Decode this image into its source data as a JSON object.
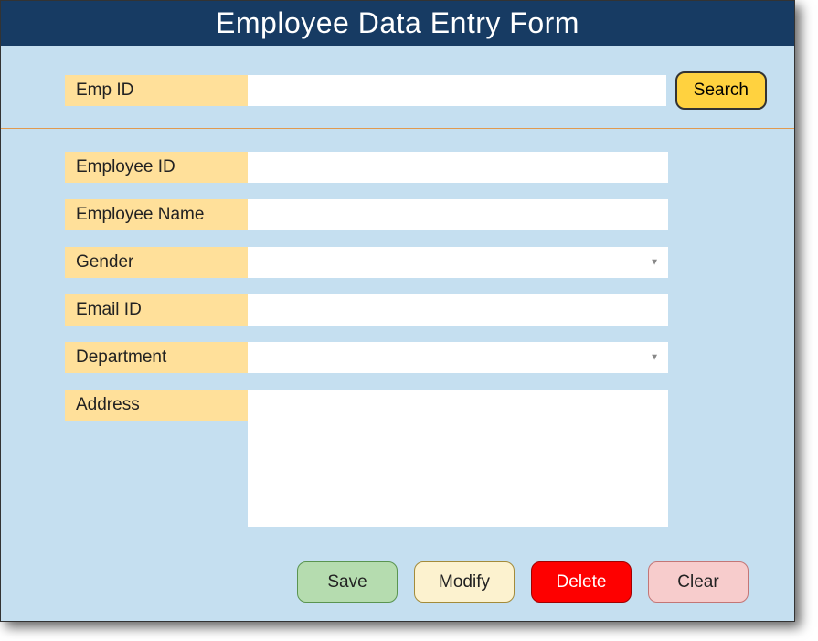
{
  "title": "Employee Data Entry Form",
  "search": {
    "label": "Emp ID",
    "value": "",
    "button_label": "Search"
  },
  "fields": {
    "employee_id": {
      "label": "Employee ID",
      "value": ""
    },
    "employee_name": {
      "label": "Employee Name",
      "value": ""
    },
    "gender": {
      "label": "Gender",
      "value": ""
    },
    "email_id": {
      "label": "Email ID",
      "value": ""
    },
    "department": {
      "label": "Department",
      "value": ""
    },
    "address": {
      "label": "Address",
      "value": ""
    }
  },
  "buttons": {
    "save": "Save",
    "modify": "Modify",
    "delete": "Delete",
    "clear": "Clear"
  }
}
